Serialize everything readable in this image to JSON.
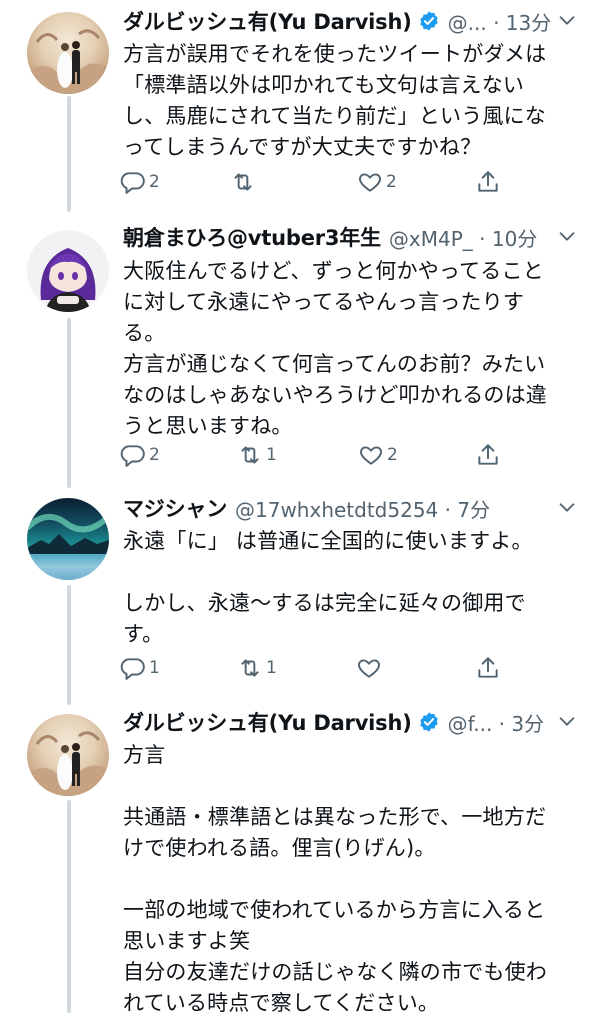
{
  "tweets": [
    {
      "name": "ダルビッシュ有(Yu Darvish)",
      "handle": "@... · 13分",
      "text": "方言が誤用でそれを使ったツイートがダメは\n「標準語以外は叩かれても文句は言えない\nし、馬鹿にされて当たり前だ」という風にな\nってしまうんですが大丈夫ですかね？",
      "replies": "2",
      "retweets": "",
      "likes": "2",
      "verified": true
    },
    {
      "name": "朝倉まひろ@vtuber3年生",
      "handle": "@xM4P_ · 10分",
      "text": "大阪住んでるけど、ずっと何かやってること\nに対して永遠にやってるやんっ言ったりす\nる。\n方言が通じなくて何言ってんのお前？みたい\nなのはしゃあないやろうけど叩かれるのは違\nうと思いますね。",
      "replies": "2",
      "retweets": "1",
      "likes": "2",
      "verified": false
    },
    {
      "name": "マジシャン",
      "handle": "@17whxhetdtd5254 · 7分",
      "text": "永遠「に」 は普通に全国的に使いますよ。\n\nしかし、永遠〜するは完全に延々の御用で\nす。",
      "replies": "1",
      "retweets": "1",
      "likes": "",
      "verified": false
    },
    {
      "name": "ダルビッシュ有(Yu Darvish)",
      "handle": "@f... · 3分",
      "text": "方言\n\n共通語・標準語とは異なった形で、一地方だ\nけで使われる語。俚言(りげん)。\n\n一部の地域で使われているから方言に入ると\n思いますよ笑\n自分の友達だけの話じゃなく隣の市でも使わ\nれている時点で察してください。",
      "verified": true
    }
  ],
  "icons": {
    "reply": "reply-icon",
    "retweet": "retweet-icon",
    "like": "heart-icon",
    "share": "share-icon",
    "verified": "verified-badge-icon",
    "more": "chevron-down-icon"
  },
  "colors": {
    "verified": "#1d9bf0",
    "secondary_text": "#536471",
    "thread_line": "#cfd9de"
  }
}
